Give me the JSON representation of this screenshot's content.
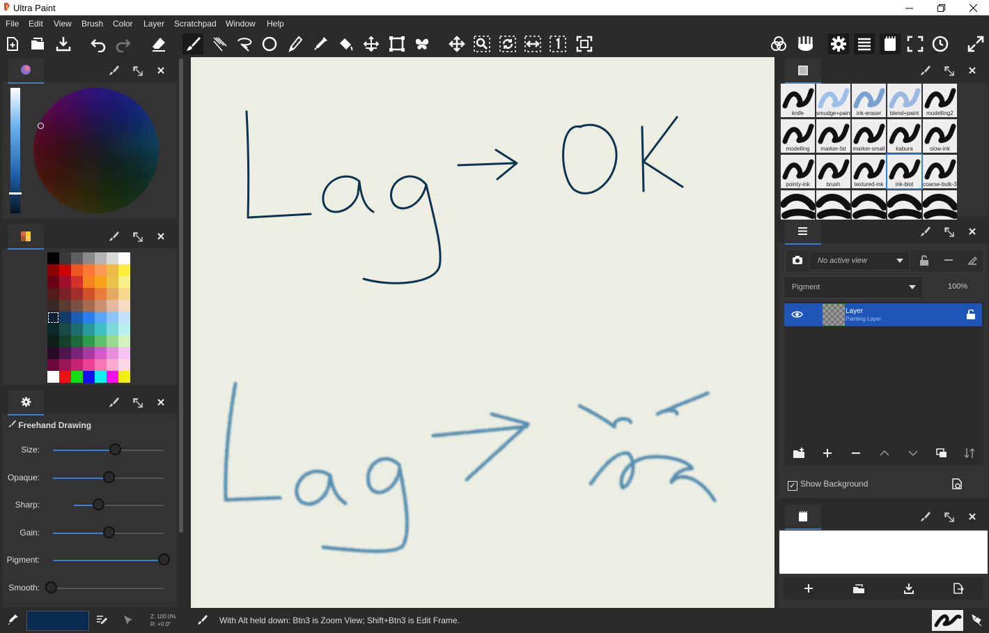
{
  "window": {
    "title": "Ultra Paint"
  },
  "menu": [
    "File",
    "Edit",
    "View",
    "Brush",
    "Color",
    "Layer",
    "Scratchpad",
    "Window",
    "Help"
  ],
  "colors": {
    "accent": "#3b7fd4",
    "layer_selected": "#1e56b8",
    "ink": "#0b3350",
    "ink_soft": "#3e7ea8",
    "current_color": "#0a2a52"
  },
  "brush_settings": {
    "title": "Freehand Drawing",
    "sliders": [
      {
        "label": "Size:",
        "value": 0.56
      },
      {
        "label": "Opaque:",
        "value": 0.5
      },
      {
        "label": "Sharp:",
        "value": 0.27
      },
      {
        "label": "Gain:",
        "value": 0.5
      },
      {
        "label": "Pigment:",
        "value": 1.0
      },
      {
        "label": "Smooth:",
        "value": 0.0
      }
    ]
  },
  "brushes": [
    [
      "knife",
      "smudge+paint",
      "ink-eraser",
      "blend+paint",
      "modelling2"
    ],
    [
      "modelling",
      "marker-fat",
      "marker-small",
      "kabura",
      "slow-ink"
    ],
    [
      "pointy-ink",
      "brush",
      "textured-ink",
      "ink-blot",
      "coarse-bulk-3"
    ],
    [
      "",
      "",
      "",
      "",
      ""
    ]
  ],
  "layers": {
    "view_dropdown": "No active view",
    "blend_mode": "Pigment",
    "opacity": "100%",
    "items": [
      {
        "name": "Layer",
        "type": "Painting Layer"
      }
    ],
    "show_background_label": "Show Background",
    "show_background_checked": true
  },
  "status": {
    "zoom": "Z: 100.0%",
    "rotation": "R: +0.0°",
    "message": "With Alt held down:  Btn3 is Zoom View;  Shift+Btn3 is Edit Frame."
  }
}
